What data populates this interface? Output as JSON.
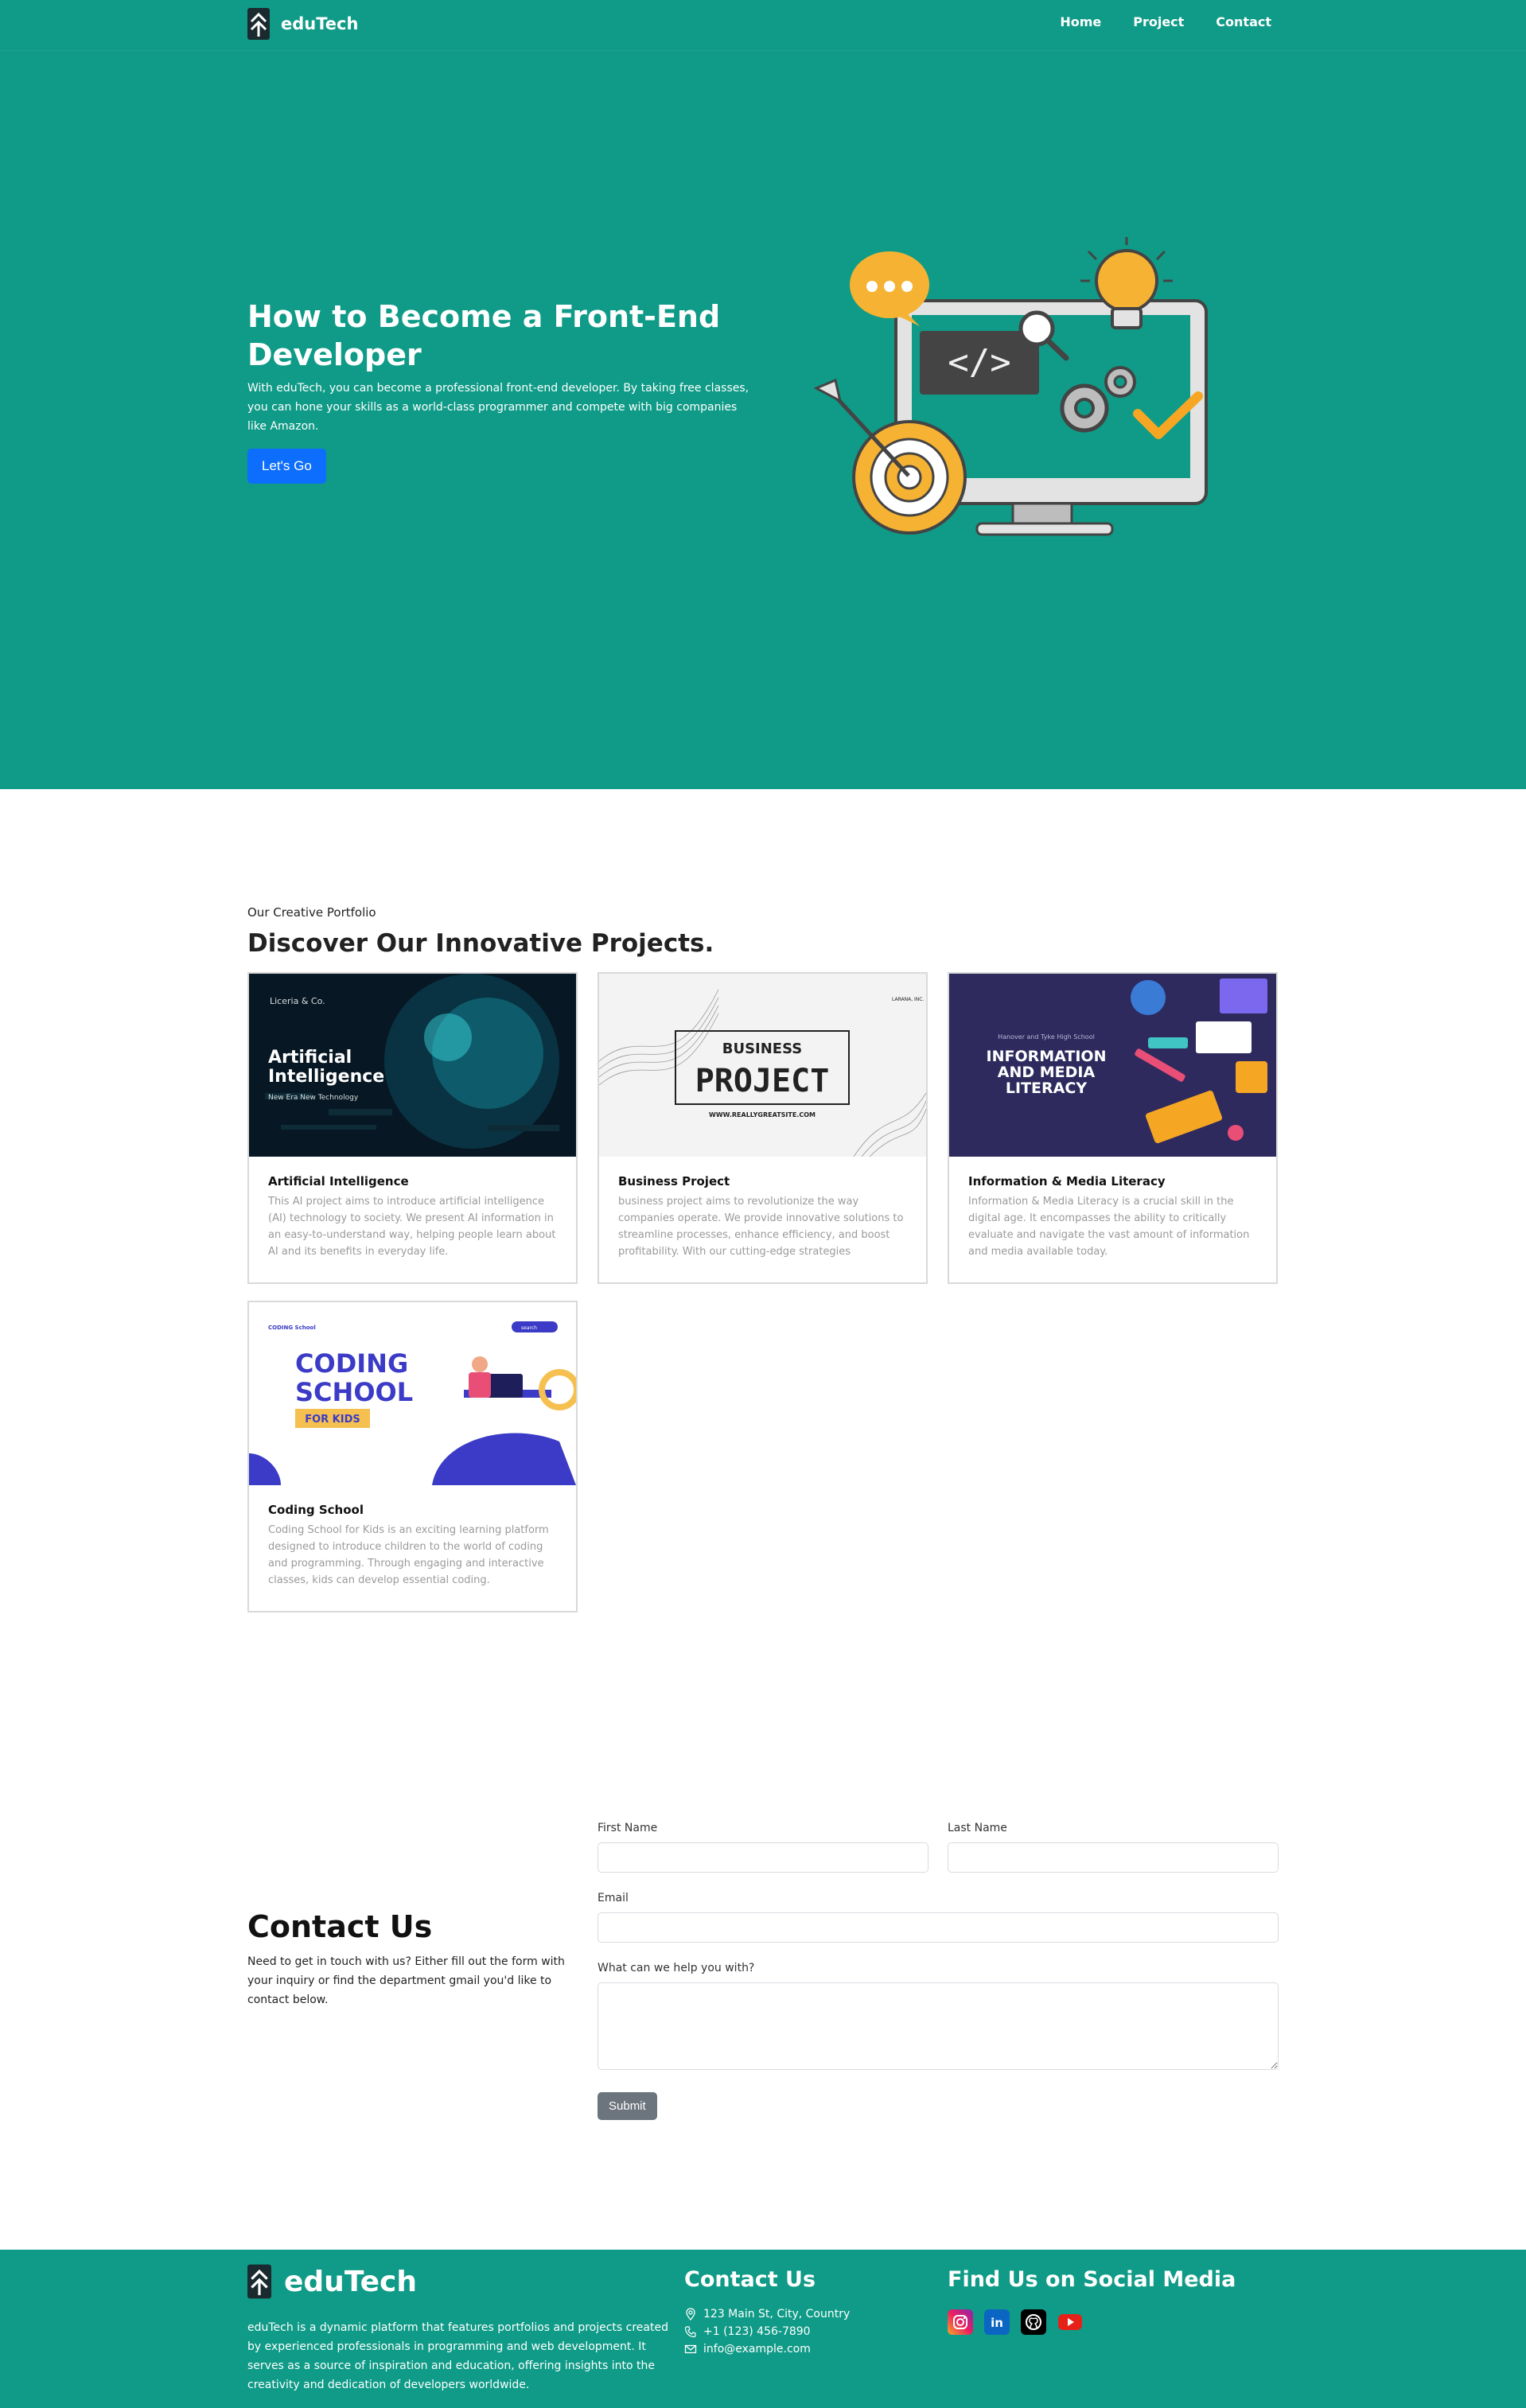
{
  "brand": {
    "name": "eduTech"
  },
  "nav": {
    "items": [
      "Home",
      "Project",
      "Contact"
    ]
  },
  "hero": {
    "title": "How to Become a Front-End Developer",
    "description": "With eduTech, you can become a professional front-end developer. By taking free classes, you can hone your skills as a world-class programmer and compete with big companies like Amazon.",
    "button": "Let's Go"
  },
  "portfolio": {
    "eyebrow": "Our Creative Portfolio",
    "title": "Discover Our Innovative Projects.",
    "cards": [
      {
        "title": "Artificial Intelligence",
        "text": "This AI project aims to introduce artificial intelligence (AI) technology to society. We present AI information in an easy-to-understand way, helping people learn about AI and its benefits in everyday life.",
        "image": {
          "brand": "Liceria & Co.",
          "headline": "Artificial Intelligence",
          "sub": "New Era New Technology"
        }
      },
      {
        "title": "Business Project",
        "text": "business project aims to revolutionize the way companies operate. We provide innovative solutions to streamline processes, enhance efficiency, and boost profitability. With our cutting-edge strategies",
        "image": {
          "brand": "LARANA, INC.",
          "line1": "BUSINESS",
          "line2": "PROJECT",
          "url": "WWW.REALLYGREATSITE.COM"
        }
      },
      {
        "title": "Information & Media Literacy",
        "text": "Information & Media Literacy is a crucial skill in the digital age. It encompasses the ability to critically evaluate and navigate the vast amount of information and media available today.",
        "image": {
          "school": "Hanover and Tyke High School",
          "headline": "INFORMATION AND MEDIA LITERACY"
        }
      },
      {
        "title": "Coding School",
        "text": "Coding School for Kids is an exciting learning platform designed to introduce children to the world of coding and programming. Through engaging and interactive classes, kids can develop essential coding.",
        "image": {
          "brand": "CODING School",
          "line1": "CODING",
          "line2": "SCHOOL",
          "badge": "FOR KIDS",
          "search": "search"
        }
      }
    ]
  },
  "contact": {
    "title": "Contact Us",
    "description": "Need to get in touch with us? Either fill out the form with your inquiry or find the department gmail you'd like to contact below.",
    "form": {
      "first_name": "First Name",
      "last_name": "Last Name",
      "email": "Email",
      "message": "What can we help you with?",
      "submit": "Submit"
    }
  },
  "footer": {
    "brand": "eduTech",
    "about": "eduTech is a dynamic platform that features portfolios and projects created by experienced professionals in programming and web development. It serves as a source of inspiration and education, offering insights into the creativity and dedication of developers worldwide.",
    "contact_title": "Contact Us",
    "address": "123 Main St, City, Country",
    "phone": "+1 (123) 456-7890",
    "email": "info@example.com",
    "social_title": "Find Us on Social Media",
    "social_icons": [
      "instagram-icon",
      "linkedin-icon",
      "github-icon",
      "youtube-icon"
    ]
  },
  "colors": {
    "teal": "#0f9b87",
    "primary_button": "#0d6efd",
    "submit_button": "#6c757d"
  }
}
